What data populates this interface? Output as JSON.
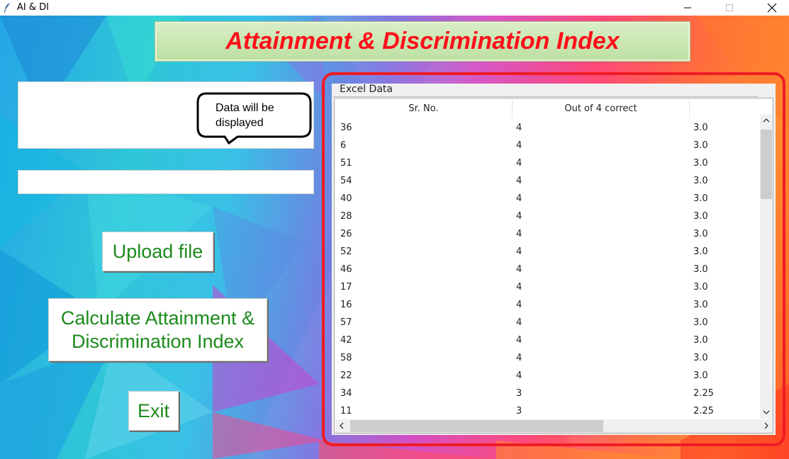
{
  "window": {
    "title": "AI & DI",
    "icon": "feather-icon",
    "controls": [
      "minimize-icon",
      "maximize-icon",
      "close-icon"
    ]
  },
  "banner": {
    "text": "Attainment & Discrimination Index",
    "color": "#ff0f1b"
  },
  "bubble": {
    "text": "Data will be displayed"
  },
  "buttons": {
    "upload": "Upload file",
    "calculate": "Calculate Attainment & Discrimination Index",
    "exit": "Exit",
    "text_color": "#1c8a1c"
  },
  "excel_panel": {
    "label": "Excel Data",
    "highlight_color": "#ee1c24",
    "columns": [
      "Sr. No.",
      "Out of 4 correct",
      ""
    ],
    "rows": [
      [
        "36",
        "4",
        "3.0"
      ],
      [
        "6",
        "4",
        "3.0"
      ],
      [
        "51",
        "4",
        "3.0"
      ],
      [
        "54",
        "4",
        "3.0"
      ],
      [
        "40",
        "4",
        "3.0"
      ],
      [
        "28",
        "4",
        "3.0"
      ],
      [
        "26",
        "4",
        "3.0"
      ],
      [
        "52",
        "4",
        "3.0"
      ],
      [
        "46",
        "4",
        "3.0"
      ],
      [
        "17",
        "4",
        "3.0"
      ],
      [
        "16",
        "4",
        "3.0"
      ],
      [
        "57",
        "4",
        "3.0"
      ],
      [
        "42",
        "4",
        "3.0"
      ],
      [
        "58",
        "4",
        "3.0"
      ],
      [
        "22",
        "4",
        "3.0"
      ],
      [
        "34",
        "3",
        "2.25"
      ],
      [
        "11",
        "3",
        "2.25"
      ]
    ]
  }
}
